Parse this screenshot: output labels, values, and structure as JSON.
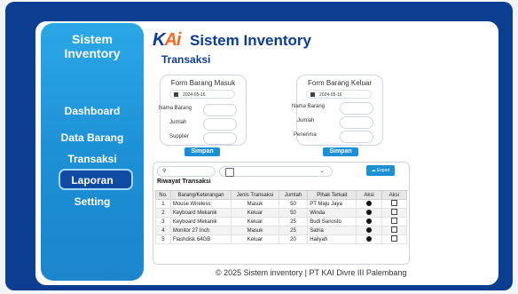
{
  "sidebar": {
    "brand_line1": "Sistem",
    "brand_line2": "Inventory",
    "items": [
      {
        "label": "Dashboard"
      },
      {
        "label": "Data Barang"
      },
      {
        "label": "Transaksi",
        "active": true
      },
      {
        "label": "Laporan"
      },
      {
        "label": "Setting"
      }
    ]
  },
  "header": {
    "logo_k": "K",
    "logo_ai": "Ai",
    "app_title": "Sistem Inventory",
    "page_title": "Transaksi"
  },
  "forms": {
    "masuk": {
      "title": "Form Barang Masuk",
      "date": "2024-05-16",
      "labels": [
        "Nama Barang",
        "Jumlah",
        "Supplier"
      ],
      "submit": "Simpan"
    },
    "keluar": {
      "title": "Form Barang Keluar",
      "date": "2024-05-16",
      "labels": [
        "Nama Barang",
        "Jumlah",
        "Penerima"
      ],
      "submit": "Simpan"
    }
  },
  "panel": {
    "export_label": "Export",
    "section_title": "Riwayat Transaksi",
    "columns": [
      "No.",
      "Barang/Keterangan",
      "Jenis Transaksi",
      "Jumlah",
      "Pihak Terkait",
      "Aksi",
      "Aksi"
    ],
    "rows": [
      {
        "no": "1",
        "barang": "Mouse Wireless",
        "jenis": "Masuk",
        "jumlah": "50",
        "pihak": "PT Maju Jaya"
      },
      {
        "no": "2",
        "barang": "Keyboard Mekanik",
        "jenis": "Keluar",
        "jumlah": "50",
        "pihak": "Winda"
      },
      {
        "no": "3",
        "barang": "Keyboard Mekanik",
        "jenis": "Keluar",
        "jumlah": "25",
        "pihak": "Budi Sanosto"
      },
      {
        "no": "4",
        "barang": "Monitor 27 Inch",
        "jenis": "Masuk",
        "jumlah": "25",
        "pihak": "Satria"
      },
      {
        "no": "5",
        "barang": "Flashdisk 64GB",
        "jenis": "Keluar",
        "jumlah": "20",
        "pihak": "Haliyah"
      }
    ]
  },
  "footer": "© 2025 Sistem inventory | PT KAI Divre III Palembang",
  "colors": {
    "frame": "#0b3d91",
    "sidebar": "#1d8fd4",
    "accent_orange": "#f26b21"
  }
}
